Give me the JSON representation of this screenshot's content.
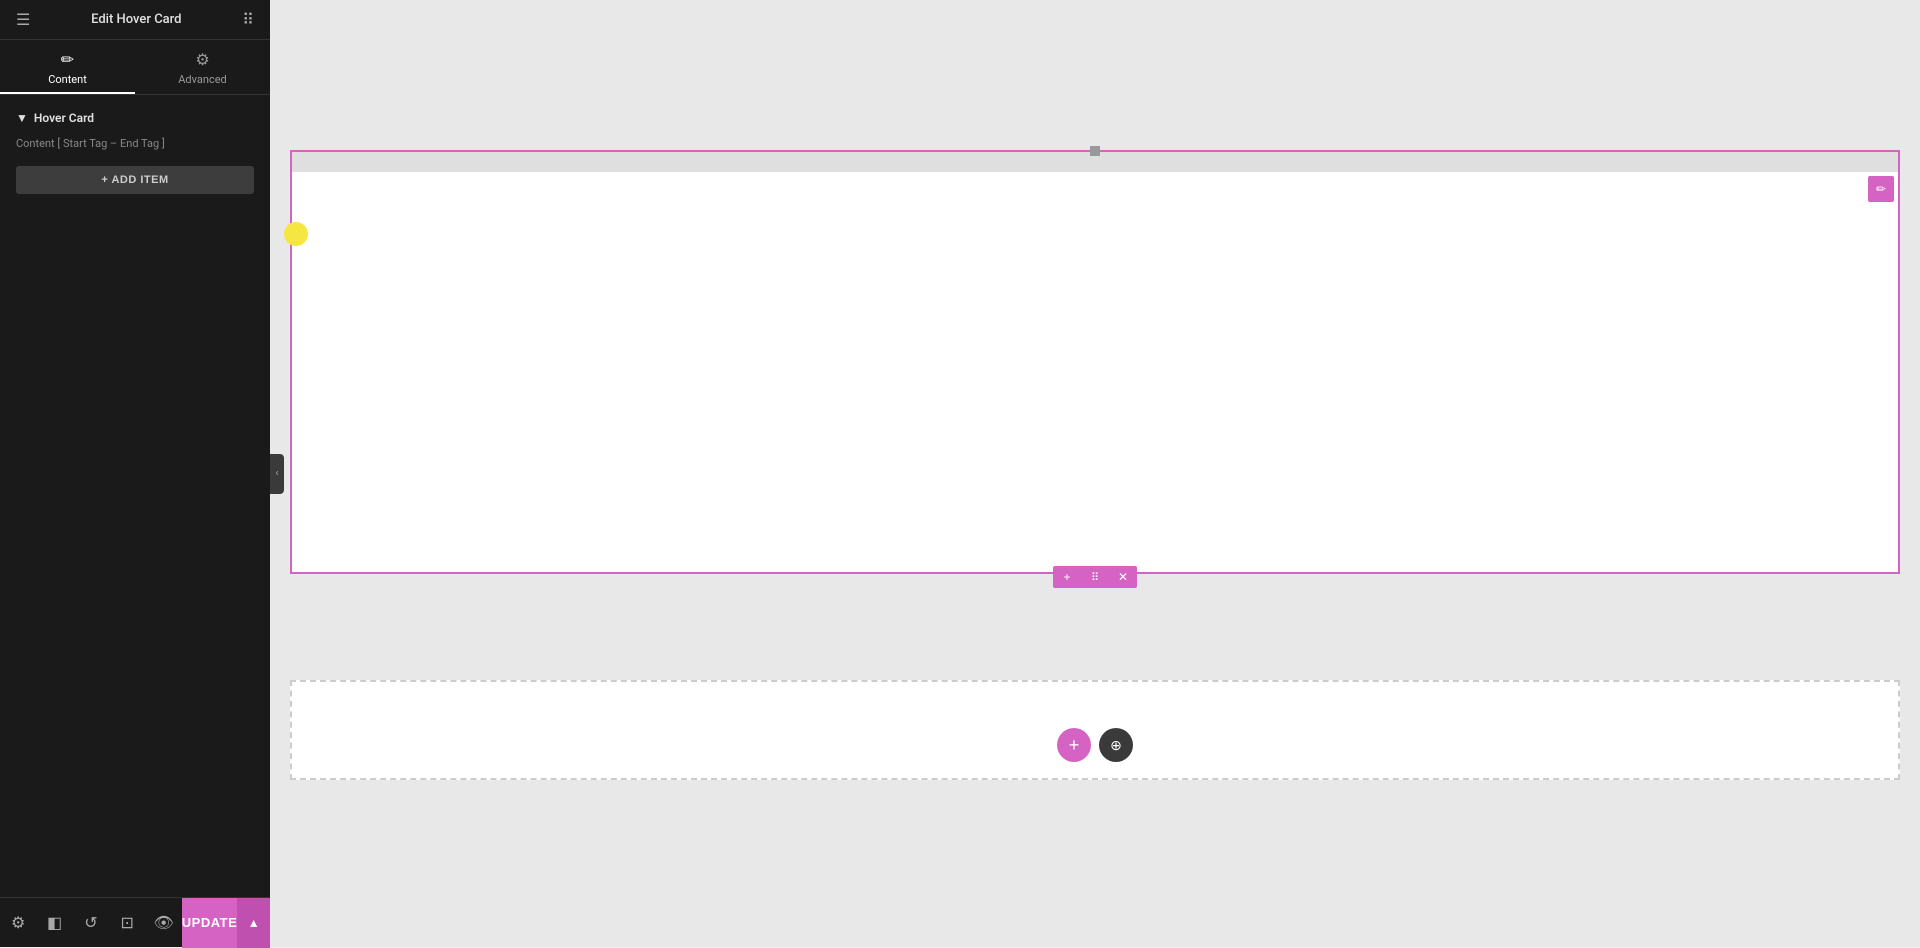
{
  "sidebar": {
    "title": "Edit Hover Card",
    "tabs": [
      {
        "id": "content",
        "label": "Content",
        "icon": "✏️",
        "active": true
      },
      {
        "id": "advanced",
        "label": "Advanced",
        "icon": "⚙️",
        "active": false
      }
    ],
    "section": {
      "label": "Hover Card",
      "chevron": "▼"
    },
    "content_tag": "Content [ Start Tag – End Tag ]",
    "add_item_label": "+ ADD ITEM",
    "footer": {
      "update_label": "UPDATE",
      "chevron_up": "▲"
    }
  },
  "canvas": {
    "drag_controls": {
      "add": "+",
      "move": "⠿",
      "remove": "✕"
    },
    "edit_icon": "✏"
  }
}
